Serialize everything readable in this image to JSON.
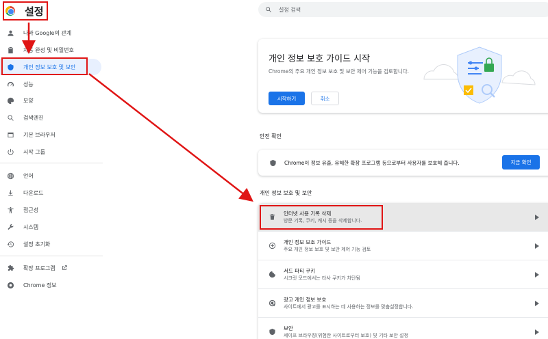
{
  "app": {
    "title": "설정"
  },
  "search": {
    "placeholder": "설정 검색"
  },
  "sidebar": {
    "items": [
      {
        "label": "나와 Google의 관계",
        "icon": "person-icon"
      },
      {
        "label": "자동 완성 및 비밀번호",
        "icon": "clipboard-icon"
      },
      {
        "label": "개인 정보 보호 및 보안",
        "icon": "shield-icon",
        "active": true
      },
      {
        "label": "성능",
        "icon": "speedometer-icon"
      },
      {
        "label": "모양",
        "icon": "palette-icon"
      },
      {
        "label": "검색엔진",
        "icon": "search-icon"
      },
      {
        "label": "기본 브라우저",
        "icon": "browser-window-icon"
      },
      {
        "label": "시작 그룹",
        "icon": "power-icon"
      },
      {
        "label": "언어",
        "icon": "globe-icon"
      },
      {
        "label": "다운로드",
        "icon": "download-icon"
      },
      {
        "label": "접근성",
        "icon": "accessibility-icon"
      },
      {
        "label": "시스템",
        "icon": "wrench-icon"
      },
      {
        "label": "설정 초기화",
        "icon": "reset-history-icon"
      },
      {
        "label": "확장 프로그램",
        "icon": "puzzle-icon"
      },
      {
        "label": "Chrome 정보",
        "icon": "chrome-icon"
      }
    ]
  },
  "guide": {
    "title": "개인 정보 보호 가이드 시작",
    "description": "Chrome의 주요 개인 정보 보호 및 보안 제어 기능을 검토합니다.",
    "start_label": "시작하기",
    "cancel_label": "취소"
  },
  "safety": {
    "heading": "안전 확인",
    "text": "Chrome이 정보 유출, 유해한 확장 프로그램 등으로부터 사용자를 보호해 줍니다.",
    "button_label": "지금 확인"
  },
  "privacy": {
    "heading": "개인 정보 보호 및 보안",
    "rows": [
      {
        "title": "인터넷 사용 기록 삭제",
        "subtitle": "방문 기록, 쿠키, 캐시 등을 삭제합니다.",
        "icon": "trash-icon"
      },
      {
        "title": "개인 정보 보호 가이드",
        "subtitle": "주요 개인 정보 보호 및 보안 제어 기능 검토",
        "icon": "add-circle-icon"
      },
      {
        "title": "서드 파티 쿠키",
        "subtitle": "시크릿 모드에서는 타사 쿠키가 차단됨",
        "icon": "cookie-icon"
      },
      {
        "title": "광고 개인 정보 보호",
        "subtitle": "사이트에서 광고를 표시하는 데 사용하는 정보를 맞춤설정합니다.",
        "icon": "ad-target-icon"
      },
      {
        "title": "보안",
        "subtitle": "세이프 브라우징(위험한 사이트로부터 보호) 및 기타 보안 설정",
        "icon": "shield-icon"
      }
    ]
  },
  "colors": {
    "accent": "#1a73e8",
    "annotation": "#e01515",
    "active_bg": "#e8f0fe"
  }
}
